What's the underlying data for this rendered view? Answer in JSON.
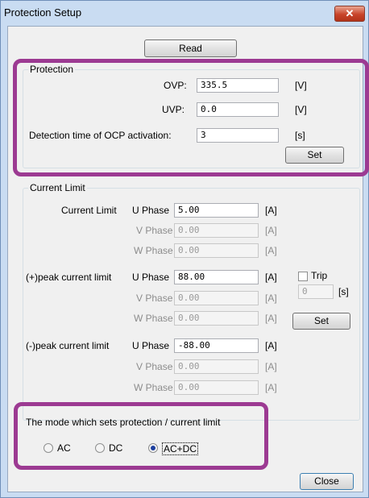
{
  "window": {
    "title": "Protection Setup",
    "close_glyph": "✕"
  },
  "buttons": {
    "read": "Read",
    "protection_set": "Set",
    "current_set": "Set",
    "close": "Close"
  },
  "protection": {
    "legend": "Protection",
    "ovp_label": "OVP:",
    "ovp_value": "335.5",
    "ovp_unit": "[V]",
    "uvp_label": "UVP:",
    "uvp_value": "0.0",
    "uvp_unit": "[V]",
    "ocp_label": "Detection time of OCP activation:",
    "ocp_value": "3",
    "ocp_unit": "[s]"
  },
  "current_limit": {
    "legend": "Current Limit",
    "groups": [
      {
        "label": "Current Limit",
        "rows": [
          {
            "phase": "U Phase",
            "value": "5.00",
            "unit": "[A]",
            "enabled": true
          },
          {
            "phase": "V Phase",
            "value": "0.00",
            "unit": "[A]",
            "enabled": false
          },
          {
            "phase": "W Phase",
            "value": "0.00",
            "unit": "[A]",
            "enabled": false
          }
        ]
      },
      {
        "label": "(+)peak current limit",
        "rows": [
          {
            "phase": "U Phase",
            "value": "88.00",
            "unit": "[A]",
            "enabled": true
          },
          {
            "phase": "V Phase",
            "value": "0.00",
            "unit": "[A]",
            "enabled": false
          },
          {
            "phase": "W Phase",
            "value": "0.00",
            "unit": "[A]",
            "enabled": false
          }
        ]
      },
      {
        "label": "(-)peak current limit",
        "rows": [
          {
            "phase": "U Phase",
            "value": "-88.00",
            "unit": "[A]",
            "enabled": true
          },
          {
            "phase": "V Phase",
            "value": "0.00",
            "unit": "[A]",
            "enabled": false
          },
          {
            "phase": "W Phase",
            "value": "0.00",
            "unit": "[A]",
            "enabled": false
          }
        ]
      }
    ],
    "trip": {
      "label": "Trip",
      "checked": false,
      "value": "0",
      "unit": "[s]"
    }
  },
  "mode": {
    "legend": "The mode which sets protection / current limit",
    "options": [
      {
        "label": "AC",
        "selected": false
      },
      {
        "label": "DC",
        "selected": false
      },
      {
        "label": "AC+DC",
        "selected": true
      }
    ]
  },
  "colors": {
    "highlight": "#9c3a92",
    "title_bar": "#c9dcf2",
    "close_button": "#c8442a"
  }
}
